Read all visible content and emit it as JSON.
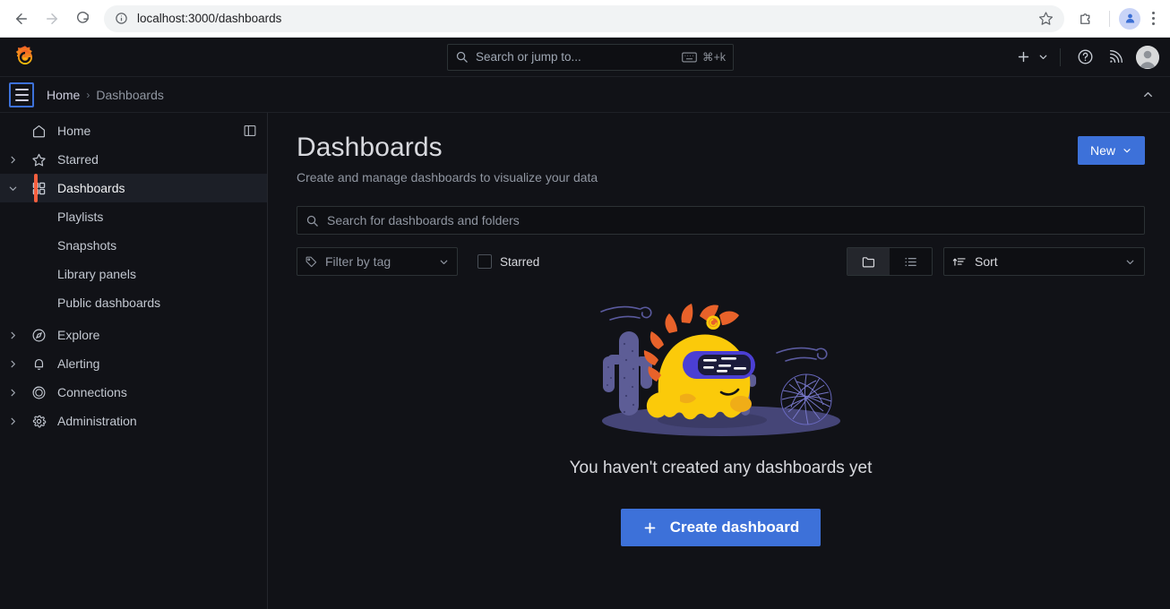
{
  "browser": {
    "url": "localhost:3000/dashboards",
    "back_icon": "back-arrow-icon",
    "forward_icon": "forward-arrow-icon",
    "reload_icon": "reload-icon",
    "info_icon": "site-info-icon",
    "bookmark_icon": "bookmark-star-icon",
    "extensions_icon": "extensions-puzzle-icon",
    "profile_icon": "chrome-profile-avatar",
    "menu_icon": "chrome-menu-kebab-icon"
  },
  "topnav": {
    "logo": "grafana-logo-icon",
    "search": {
      "placeholder": "Search or jump to...",
      "icon": "search-icon",
      "keyboard_icon": "keyboard-icon",
      "shortcut": "⌘+k"
    },
    "add_label": "",
    "add_icon": "plus-icon",
    "add_chevron_icon": "chevron-down-icon",
    "help_icon": "help-circle-icon",
    "news_icon": "rss-news-icon",
    "avatar": "user-avatar"
  },
  "breadcrumb": {
    "menu_icon": "hamburger-menu-icon",
    "items": [
      {
        "label": "Home",
        "current": false
      },
      {
        "label": "Dashboards",
        "current": true
      }
    ],
    "separator": "›",
    "collapse_icon": "chevron-up-icon"
  },
  "sidebar": {
    "dock_icon": "dock-menu-icon",
    "items": [
      {
        "label": "Home",
        "icon": "home-icon",
        "expandable": false,
        "active": false
      },
      {
        "label": "Starred",
        "icon": "star-icon",
        "expandable": true,
        "active": false
      },
      {
        "label": "Dashboards",
        "icon": "apps-grid-icon",
        "expandable": true,
        "expanded": true,
        "active": true
      },
      {
        "label": "Explore",
        "icon": "compass-icon",
        "expandable": true,
        "active": false
      },
      {
        "label": "Alerting",
        "icon": "bell-icon",
        "expandable": true,
        "active": false
      },
      {
        "label": "Connections",
        "icon": "connections-icon",
        "expandable": true,
        "active": false
      },
      {
        "label": "Administration",
        "icon": "gear-icon",
        "expandable": true,
        "active": false
      }
    ],
    "dashboards_children": [
      {
        "label": "Playlists"
      },
      {
        "label": "Snapshots"
      },
      {
        "label": "Library panels"
      },
      {
        "label": "Public dashboards"
      }
    ]
  },
  "page": {
    "title": "Dashboards",
    "subtitle": "Create and manage dashboards to visualize your data",
    "new_button": {
      "label": "New",
      "chevron_icon": "chevron-down-icon"
    },
    "search": {
      "placeholder": "Search for dashboards and folders",
      "value": "",
      "icon": "search-icon"
    },
    "filters": {
      "tag": {
        "label": "Filter by tag",
        "icon": "tag-icon",
        "chevron_icon": "chevron-down-icon"
      },
      "starred": {
        "label": "Starred",
        "checked": false
      }
    },
    "view_toggle": {
      "folder": {
        "icon": "folder-icon",
        "active": true
      },
      "list": {
        "icon": "list-icon",
        "active": false
      }
    },
    "sort": {
      "label": "Sort",
      "icon": "sort-amount-icon",
      "chevron_icon": "chevron-down-icon"
    },
    "empty_state": {
      "illustration": "grafana-mascot-vr-illustration",
      "title": "You haven't created any dashboards yet",
      "button": {
        "label": "Create dashboard",
        "icon": "plus-icon"
      }
    }
  },
  "colors": {
    "accent_blue": "#3d71d9",
    "brand_orange": "#f55f3e",
    "background": "#111217",
    "panel": "#0e0f13",
    "border": "#2c3235",
    "text_primary": "#d8d9de",
    "text_secondary": "#9096a1"
  }
}
